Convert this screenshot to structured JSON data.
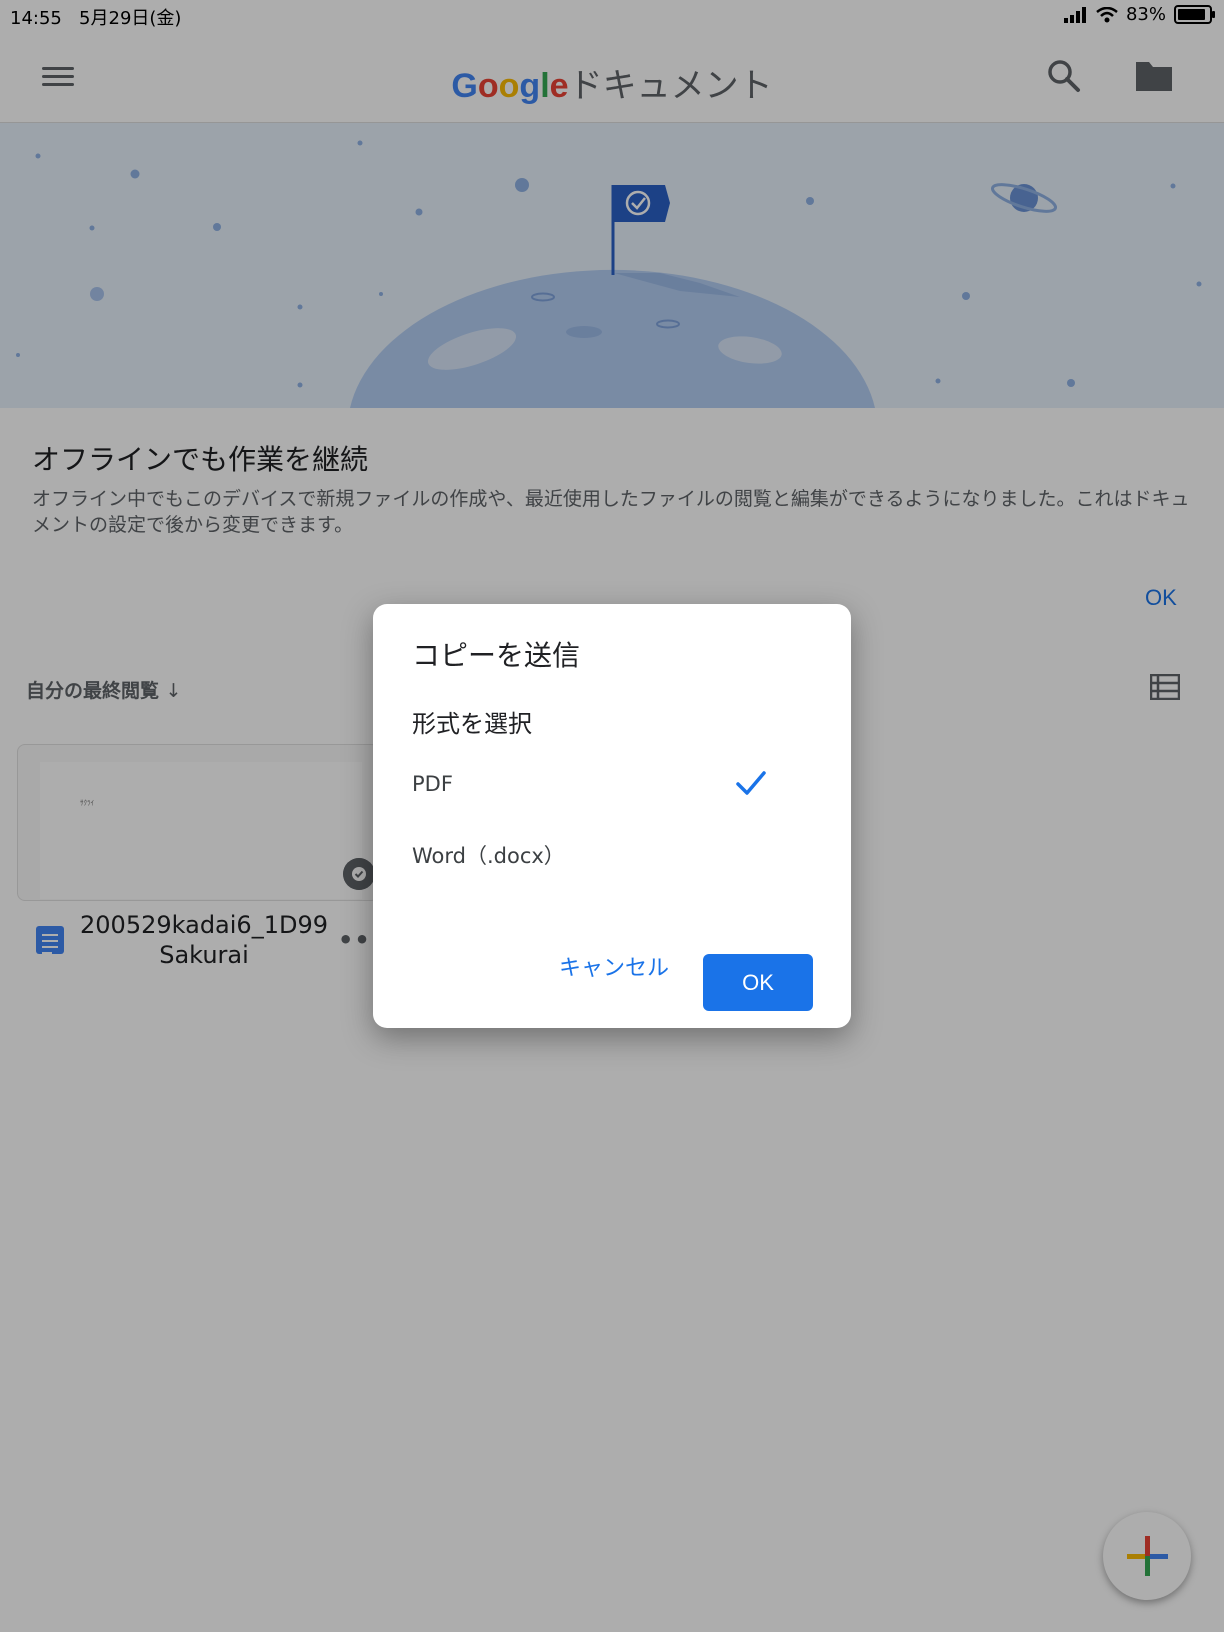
{
  "status_bar": {
    "time": "14:55",
    "date": "5月29日(金)",
    "battery": "83%"
  },
  "app_bar": {
    "logo_text": "Google",
    "title": "ドキュメント"
  },
  "offline_notice": {
    "title": "オフラインでも作業を継続",
    "body": "オフライン中でもこのデバイスで新規ファイルの作成や、最近使用したファイルの閲覧と編集ができるようになりました。これはドキュメントの設定で後から変更できます。",
    "ok_label": "OK"
  },
  "sort": {
    "label": "自分の最終閲覧",
    "arrow": "↓"
  },
  "documents": [
    {
      "name": "200529kadai6_1D99 Sakurai",
      "snippet": "ｻｸﾗｲ"
    }
  ],
  "dialog": {
    "title": "コピーを送信",
    "subtitle": "形式を選択",
    "options": [
      {
        "label": "PDF",
        "selected": true
      },
      {
        "label": "Word（.docx）",
        "selected": false
      }
    ],
    "cancel_label": "キャンセル",
    "ok_label": "OK"
  },
  "colors": {
    "accent": "#1a73e8",
    "scrim": "rgba(0,0,0,0.32)"
  },
  "icons": {
    "menu": "hamburger-menu-icon",
    "search": "search-icon",
    "folder": "folder-icon",
    "list_view": "list-view-icon",
    "check": "check-icon",
    "fab": "plus-icon"
  }
}
